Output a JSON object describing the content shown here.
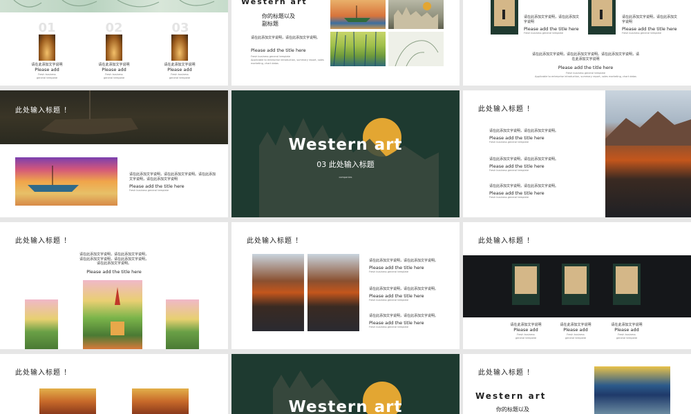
{
  "brand": {
    "accent": "#1e3a30",
    "sun": "#e3a632"
  },
  "s1": {
    "items": [
      {
        "num": "01",
        "cn": "请在此添加文字说明",
        "en": "Please add",
        "tiny": "Fresh business general template"
      },
      {
        "num": "02",
        "cn": "请在此添加文字说明",
        "en": "Please add",
        "tiny": "Fresh business general template"
      },
      {
        "num": "03",
        "cn": "请在此添加文字说明",
        "en": "Please add",
        "tiny": "Fresh business general template"
      }
    ]
  },
  "s2": {
    "title": "Western art",
    "sub1": "你的标题以及",
    "sub2": "副标题",
    "cn": "请在此添加文字说明，请在此添加文字说明。",
    "en": "Please add the title here",
    "tiny1": "Fresh business general template",
    "tiny2": "Applicable to enterprise introduction, summary report, sales marketing, chart datas"
  },
  "s3": {
    "items": [
      {
        "cn": "请在此添加文字说明，请在此添加文字说明",
        "en": "Please add the title here",
        "tiny": "Fresh business general template"
      },
      {
        "cn": "请在此添加文字说明，请在此添加文字说明",
        "en": "Please add the title here",
        "tiny": "Fresh business general template"
      }
    ],
    "cn": "请在此添加文字说明，请在此添加文字说明。请在此添加文字说明，请在此添加文字说明",
    "en": "Please add the title here",
    "tiny1": "Fresh business general template",
    "tiny2": "Applicable to enterprise introduction, summary report, sales marketing, chart datas"
  },
  "s4": {
    "title": "此处输入标题 ！",
    "cn": "请在此添加文字说明，请在此添加文字说明。请在此添加文字说明，请在此添加文字说明",
    "en": "Please add the title here",
    "tiny": "Fresh business general template"
  },
  "s5": {
    "title": "Western art",
    "sub": "03  此处输入标题",
    "tiny": "companies"
  },
  "s6": {
    "title": "此处输入标题 ！",
    "items": [
      {
        "cn": "请在此添加文字说明，请在此添加文字说明。",
        "en": "Please add the title here",
        "tiny": "Fresh business general template"
      },
      {
        "cn": "请在此添加文字说明，请在此添加文字说明。",
        "en": "Please add the title here",
        "tiny": "Fresh business general template"
      },
      {
        "cn": "请在此添加文字说明，请在此添加文字说明。",
        "en": "Please add the title here",
        "tiny": "Fresh business general template"
      }
    ]
  },
  "s7": {
    "title": "此处输入标题 ！",
    "cn": "请在此添加文字说明，请在此添加文字说明，请在此添加文字说明，请在此添加文字说明，请在此添加文字说明。",
    "en": "Please add the title here"
  },
  "s8": {
    "title": "此处输入标题 ！",
    "items": [
      {
        "cn": "请在此添加文字说明，请在此添加文字说明。",
        "en": "Please add the title here",
        "tiny": "Fresh business general template"
      },
      {
        "cn": "请在此添加文字说明，请在此添加文字说明。",
        "en": "Please add the title here",
        "tiny": "Fresh business general template"
      },
      {
        "cn": "请在此添加文字说明，请在此添加文字说明。",
        "en": "Please add the title here",
        "tiny": "Fresh business general template"
      }
    ]
  },
  "s9": {
    "title": "此处输入标题 ！",
    "items": [
      {
        "cn": "请在此添加文字说明",
        "en": "Please add",
        "tiny": "Fresh business general template"
      },
      {
        "cn": "请在此添加文字说明",
        "en": "Please add",
        "tiny": "Fresh business general template"
      },
      {
        "cn": "请在此添加文字说明",
        "en": "Please add",
        "tiny": "Fresh business general template"
      }
    ]
  },
  "s10": {
    "title": "此处输入标题 ！"
  },
  "s11": {
    "title": "Western art"
  },
  "s12": {
    "title": "此处输入标题 ！",
    "heading": "Western art",
    "sub": "你的标题以及"
  }
}
